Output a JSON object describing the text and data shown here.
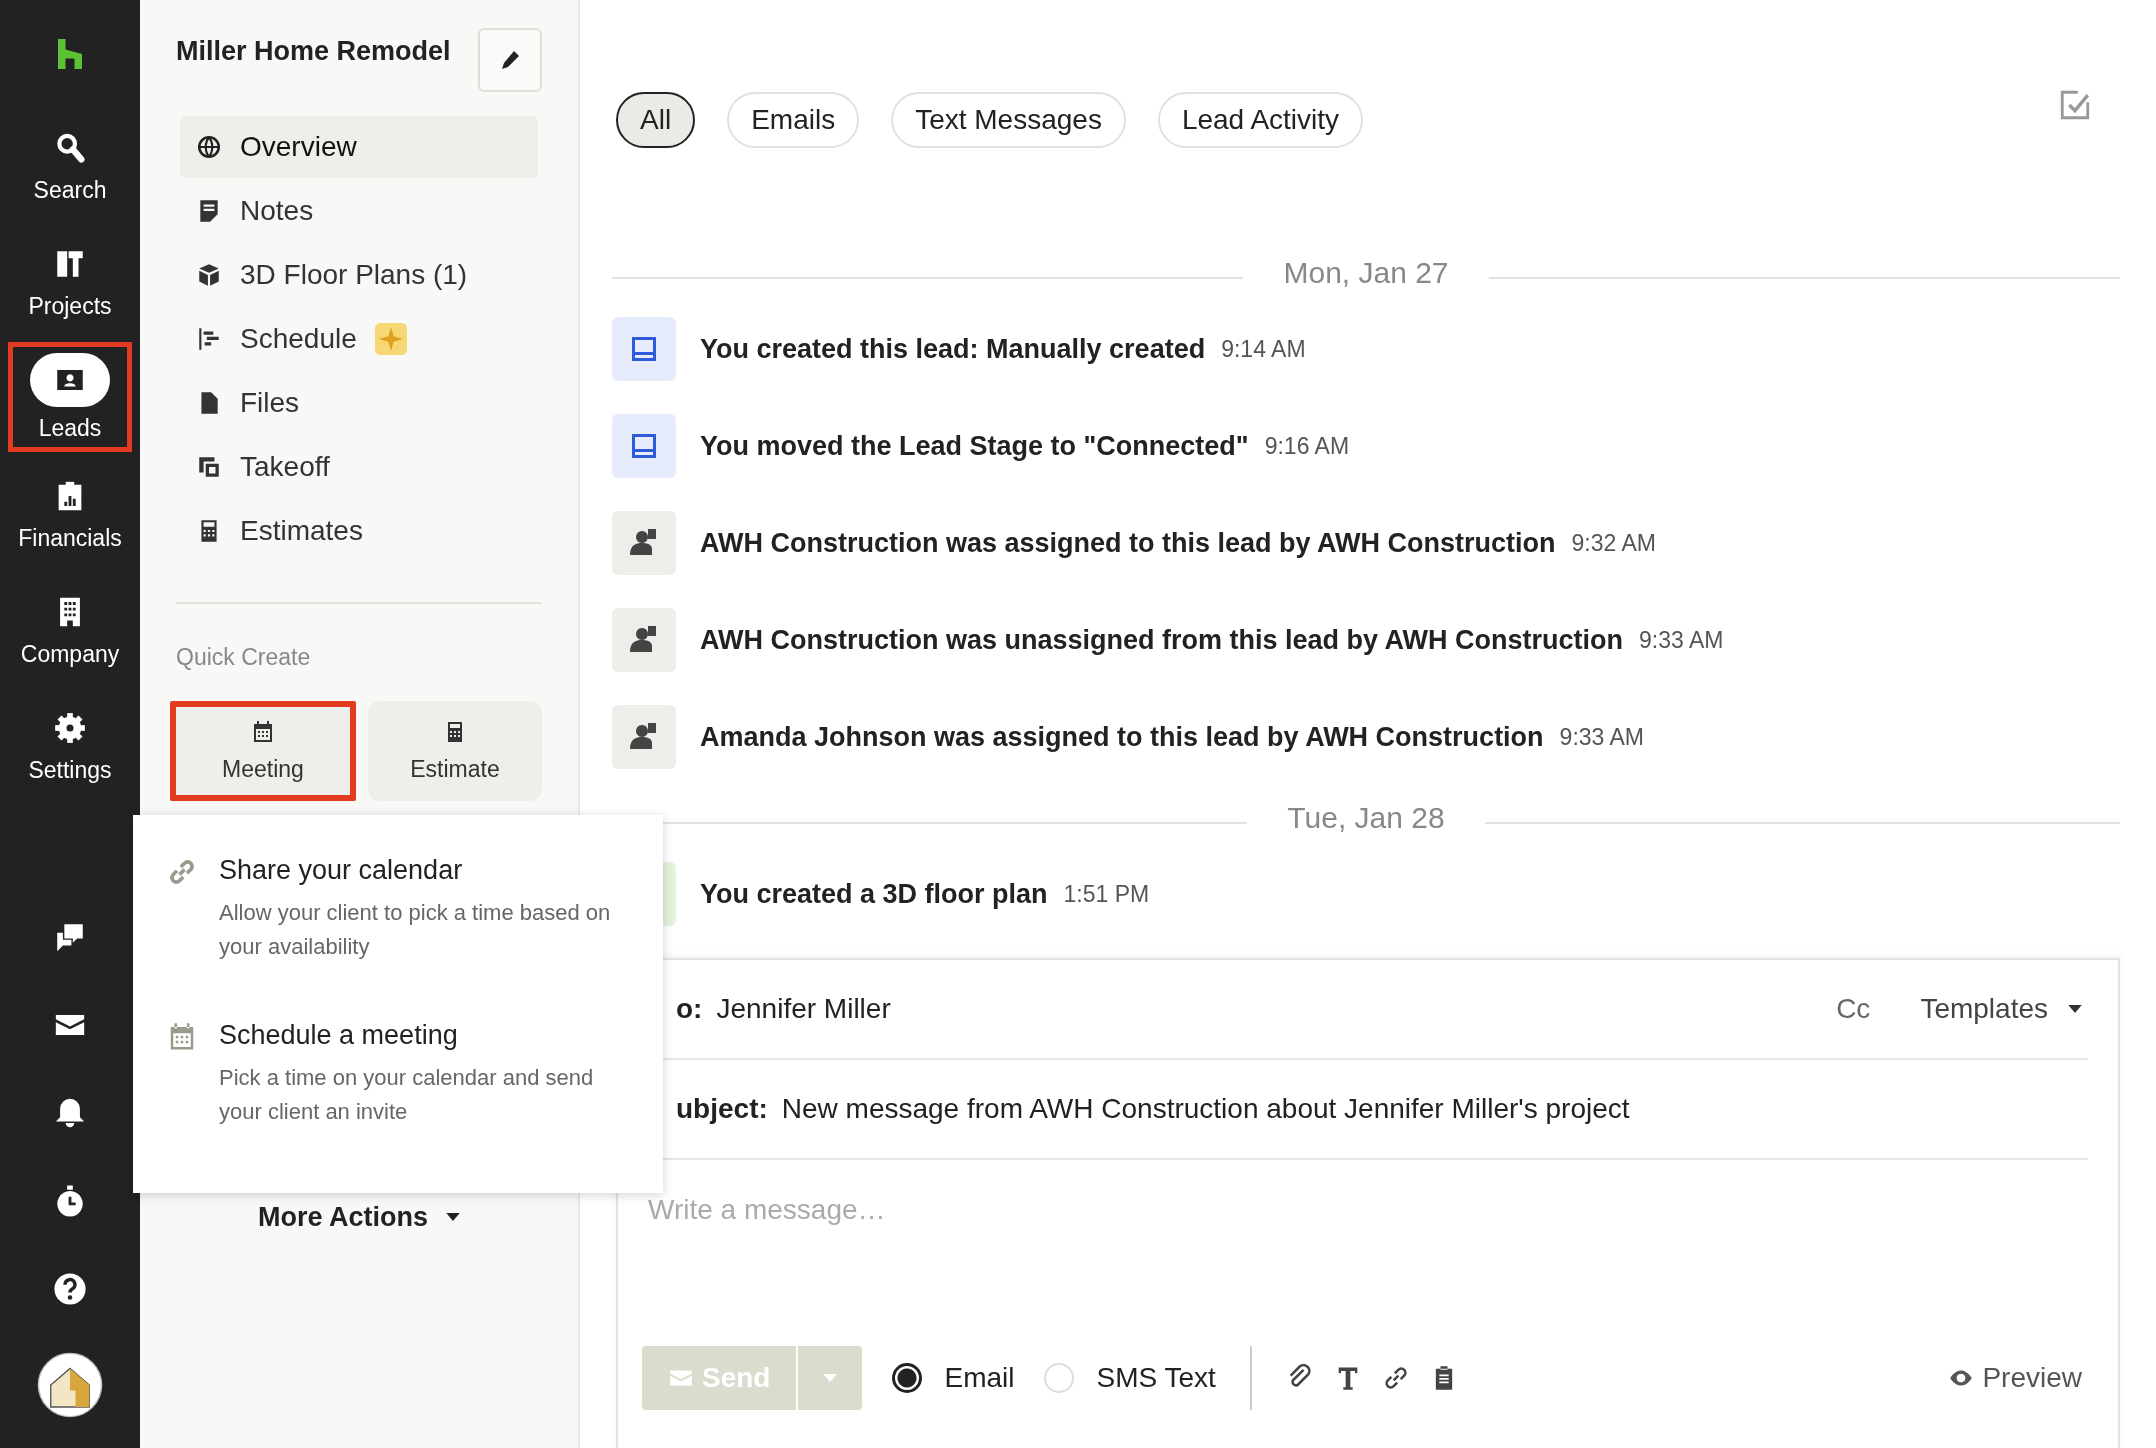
{
  "nav": {
    "items": [
      {
        "kind": "search",
        "label": "Search",
        "selected": false,
        "highlighted": false
      },
      {
        "kind": "projects",
        "label": "Projects",
        "selected": false,
        "highlighted": false
      },
      {
        "kind": "leads",
        "label": "Leads",
        "selected": true,
        "highlighted": true
      },
      {
        "kind": "financials",
        "label": "Financials",
        "selected": false,
        "highlighted": false
      },
      {
        "kind": "company",
        "label": "Company",
        "selected": false,
        "highlighted": false
      },
      {
        "kind": "settings",
        "label": "Settings",
        "selected": false,
        "highlighted": false
      }
    ],
    "bottom_icons": [
      {
        "kind": "chat"
      },
      {
        "kind": "mail"
      },
      {
        "kind": "bell"
      },
      {
        "kind": "timer"
      },
      {
        "kind": "help"
      },
      {
        "kind": "avatar"
      }
    ]
  },
  "sidebar": {
    "title": "Miller Home Remodel",
    "items": [
      {
        "kind": "globe",
        "label": "Overview",
        "selected": true,
        "badge": false
      },
      {
        "kind": "note",
        "label": "Notes",
        "selected": false,
        "badge": false
      },
      {
        "kind": "cube",
        "label": "3D Floor Plans (1)",
        "selected": false,
        "badge": false
      },
      {
        "kind": "schedule",
        "label": "Schedule",
        "selected": false,
        "badge": true
      },
      {
        "kind": "file",
        "label": "Files",
        "selected": false,
        "badge": false
      },
      {
        "kind": "takeoff",
        "label": "Takeoff",
        "selected": false,
        "badge": false
      },
      {
        "kind": "calculator",
        "label": "Estimates",
        "selected": false,
        "badge": false
      }
    ],
    "quick_create": {
      "heading": "Quick Create",
      "buttons": [
        {
          "kind": "calendar",
          "label": "Meeting",
          "highlighted": true
        },
        {
          "kind": "calculator",
          "label": "Estimate",
          "highlighted": false
        }
      ]
    },
    "more_actions": "More Actions"
  },
  "popup": {
    "items": [
      {
        "kind": "link",
        "title": "Share your calendar",
        "description": "Allow your client to pick a time based on your availability"
      },
      {
        "kind": "calendar",
        "title": "Schedule a meeting",
        "description": "Pick a time on your calendar and send your client an invite"
      }
    ]
  },
  "filters": [
    {
      "label": "All",
      "selected": true
    },
    {
      "label": "Emails",
      "selected": false
    },
    {
      "label": "Text Messages",
      "selected": false
    },
    {
      "label": "Lead Activity",
      "selected": false
    }
  ],
  "timeline": [
    {
      "date": "Mon, Jan 27",
      "events": [
        {
          "kind": "inbox",
          "text": "You created this lead: Manually created",
          "time": "9:14 AM"
        },
        {
          "kind": "inbox",
          "text": "You moved the Lead Stage to \"Connected\"",
          "time": "9:16 AM"
        },
        {
          "kind": "person",
          "text": "AWH Construction was assigned to this lead by AWH Construction",
          "time": "9:32 AM"
        },
        {
          "kind": "person",
          "text": "AWH Construction was unassigned from this lead by AWH Construction",
          "time": "9:33 AM"
        },
        {
          "kind": "person",
          "text": "Amanda Johnson was assigned to this lead by AWH Construction",
          "time": "9:33 AM"
        }
      ]
    },
    {
      "date": "Tue, Jan 28",
      "events": [
        {
          "kind": "plan",
          "text": "You created a 3D floor plan",
          "time": "1:51 PM"
        }
      ]
    }
  ],
  "composer": {
    "to_label": "o:",
    "to": "Jennifer Miller",
    "cc": "Cc",
    "templates": "Templates",
    "subject_label": "ubject:",
    "subject": "New message from AWH Construction about Jennifer Miller's project",
    "placeholder": "Write a message…",
    "send": "Send",
    "send_disabled": true,
    "channels": [
      {
        "label": "Email",
        "selected": true
      },
      {
        "label": "SMS Text",
        "selected": false
      }
    ],
    "tools": [
      {
        "kind": "paperclip"
      },
      {
        "kind": "text"
      },
      {
        "kind": "link"
      },
      {
        "kind": "clipboard"
      }
    ],
    "preview": "Preview"
  }
}
